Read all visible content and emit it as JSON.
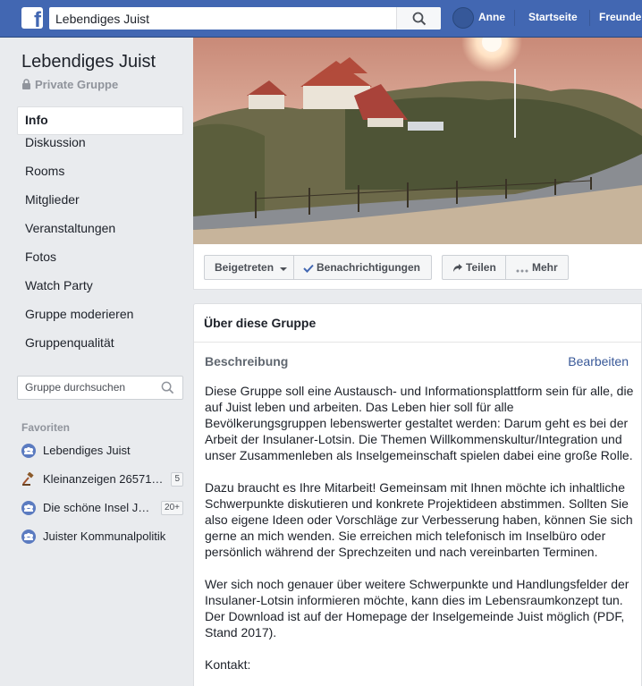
{
  "topbar": {
    "logo": "f",
    "search_value": "Lebendiges Juist",
    "user": "Anne",
    "home": "Startseite",
    "friends": "Freunde"
  },
  "group": {
    "name": "Lebendiges Juist",
    "privacy": "Private Gruppe"
  },
  "nav": [
    "Info",
    "Diskussion",
    "Rooms",
    "Mitglieder",
    "Veranstaltungen",
    "Fotos",
    "Watch Party",
    "Gruppe moderieren",
    "Gruppenqualität"
  ],
  "group_search_placeholder": "Gruppe durchsuchen",
  "favorites": {
    "heading": "Favoriten",
    "items": [
      {
        "label": "Lebendiges Juist",
        "badge": ""
      },
      {
        "label": "Kleinanzeigen 26571…",
        "badge": "5"
      },
      {
        "label": "Die schöne Insel J…",
        "badge": "20+"
      },
      {
        "label": "Juister Kommunalpolitik",
        "badge": ""
      }
    ]
  },
  "actions": {
    "joined": "Beigetreten",
    "notifications": "Benachrichtigungen",
    "share": "Teilen",
    "more": "Mehr"
  },
  "about": {
    "title": "Über diese Gruppe",
    "desc_label": "Beschreibung",
    "edit": "Bearbeiten",
    "paragraphs": [
      "Diese Gruppe soll eine Austausch- und Informationsplattform sein für alle, die auf Juist leben und arbeiten. Das Leben hier soll für alle Bevölkerungsgruppen lebenswerter gestaltet werden: Darum geht es bei der Arbeit der Insulaner-Lotsin. Die Themen Willkommenskultur/Integration und unser Zusammenleben als Inselgemeinschaft spielen dabei eine große Rolle.",
      "Dazu braucht es Ihre Mitarbeit! Gemeinsam mit Ihnen möchte ich inhaltliche Schwerpunkte diskutieren und konkrete Projektideen abstimmen. Sollten Sie also eigene Ideen oder Vorschläge zur Verbesserung haben, können Sie sich gerne an mich wenden. Sie erreichen mich telefonisch im Inselbüro oder persönlich während der Sprechzeiten und nach vereinbarten Terminen.",
      "Wer sich noch genauer über weitere Schwerpunkte und Handlungsfelder der Insulaner-Lotsin informieren möchte, kann dies im Lebensraumkonzept tun. Der Download ist auf der Homepage der Inselgemeinde Juist möglich (PDF, Stand 2017).",
      "Kontakt:"
    ]
  },
  "colors": {
    "brand": "#4267b2",
    "link": "#385898",
    "page_bg": "#e9ebee"
  },
  "icons": [
    "search-icon",
    "lock-icon",
    "people-icon",
    "gavel-icon",
    "caret-down-icon",
    "check-icon",
    "share-icon",
    "more-icon"
  ]
}
